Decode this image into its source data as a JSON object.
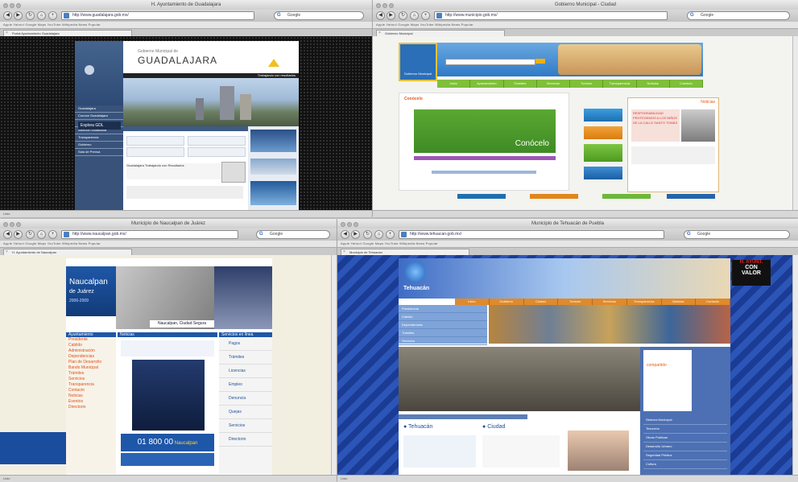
{
  "windows": [
    {
      "id": "w1",
      "title": "H. Ayuntamiento de Guadalajara",
      "url": "http://www.guadalajara.gob.mx/",
      "search": "Google",
      "tab": "Portal Ayuntamiento Guadalajara",
      "bookmarks": "Apple  Yahoo!  Google Maps  YouTube  Wikipedia  News  Popular",
      "status": "Listo",
      "site": {
        "city_name": "GUADALAJARA",
        "header_small": "Gobierno Municipal de",
        "tagline": "Trabajando con resultados",
        "nav": [
          "Guadalajara",
          "Conoce Guadalajara",
          "Trámites y servicios",
          "Atención ciudadana",
          "Transparencia",
          "Gobierno",
          "Sala de Prensa"
        ],
        "promo_1": "Explora GDL",
        "headline": "Guadalajara Trabajando con Resultados"
      }
    },
    {
      "id": "w2",
      "title": "Gobierno Municipal - Ciudad",
      "url": "http://www.municipio.gob.mx/",
      "search": "Google",
      "tab": "Gobierno Municipal",
      "bookmarks": "Apple  Yahoo!  Google Maps  YouTube  Wikipedia  News  Popular",
      "status": "",
      "site": {
        "logo_text": "Gobierno Municipal",
        "menu": [
          "Inicio",
          "Ayuntamiento",
          "Trámites",
          "Servicios",
          "Turismo",
          "Transparencia",
          "Noticias",
          "Contacto"
        ],
        "section_label": "Conócelo",
        "banner_caption": "Conócelo",
        "news_title": "Noticias",
        "news_headline": "RESPONSABILIDAD PROTEGEMOS A LOS NIÑOS DE LA CALLE SANTO TOMÁS"
      }
    },
    {
      "id": "w3",
      "title": "Municipio de Naucalpan de Juárez",
      "url": "http://www.naucalpan.gob.mx/",
      "search": "Google",
      "tab": "H. Ayuntamiento de Naucalpan",
      "bookmarks": "Apple  Yahoo!  Google Maps  YouTube  Wikipedia  News  Popular",
      "status": "Listo",
      "site": {
        "header_title": "Naucalpan",
        "header_sub": "de Juárez",
        "period": "2006-2009",
        "banner_slogan": "Naucalpan, Ciudad Segura",
        "left_menu_title": "Ayuntamiento",
        "left_menu": [
          "Presidente",
          "Cabildo",
          "Administración",
          "Dependencias",
          "Plan de Desarrollo",
          "Bando Municipal",
          "Trámites",
          "Servicios",
          "Transparencia",
          "Contacto",
          "Noticias",
          "Eventos",
          "Directorio"
        ],
        "center_title": "Noticias",
        "phone_label": "01 800 00",
        "phone_number": "Naucalpan",
        "right_menu_title": "Servicios en línea",
        "right_menu": [
          "Pagos",
          "Trámites",
          "Licencias",
          "Empleo",
          "Denuncia",
          "Quejas",
          "Servicios",
          "Directorio"
        ]
      }
    },
    {
      "id": "w4",
      "title": "Municipio de Tehuacán de Puebla",
      "url": "http://www.tehuacan.gob.mx/",
      "search": "Google",
      "tab": "Municipio de Tehuacán",
      "bookmarks": "Apple  Yahoo!  Google Maps  YouTube  Wikipedia  News  Popular",
      "status": "Listo",
      "site": {
        "logo_text": "Tehuacán",
        "corner_badge_line1": "H. AYUNT.",
        "corner_badge_line2": "CON",
        "corner_badge_line3": "VALOR",
        "top_nav": [
          "Inicio",
          "Gobierno",
          "Ciudad",
          "Turismo",
          "Servicios",
          "Transparencia",
          "Noticias",
          "Contacto"
        ],
        "left_links": [
          "Presidencia",
          "Cabildo",
          "Dependencias",
          "Trámites",
          "Servicios"
        ],
        "section_1": "Tehuacán",
        "section_2": "Ciudad",
        "promo_label": "compartido",
        "right_items": [
          "Sistema Municipal",
          "Tesorería",
          "Obras Públicas",
          "Desarrollo Urbano",
          "Seguridad Pública",
          "Cultura"
        ]
      }
    }
  ]
}
